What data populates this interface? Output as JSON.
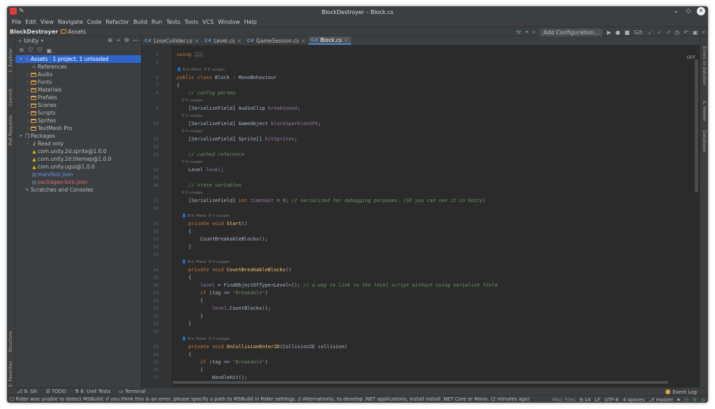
{
  "window": {
    "title": "BlockDestroyer – Block.cs"
  },
  "menu": [
    "File",
    "Edit",
    "View",
    "Navigate",
    "Code",
    "Refactor",
    "Build",
    "Run",
    "Tests",
    "Tools",
    "VCS",
    "Window",
    "Help"
  ],
  "breadcrumb": {
    "project": "BlockDestroyer",
    "folder": "Assets"
  },
  "toolbar": {
    "add_config": "Add Configuration...",
    "git_label": "Git:"
  },
  "project_panel": {
    "title": "Unity"
  },
  "tree": [
    {
      "indent": 0,
      "arrow": "▾",
      "icon": "unity",
      "label": "Assets · 1 project, 1 unloaded",
      "selected": true
    },
    {
      "indent": 1,
      "arrow": "",
      "icon": "refs",
      "label": "References"
    },
    {
      "indent": 1,
      "arrow": "›",
      "icon": "folder",
      "label": "Audio"
    },
    {
      "indent": 1,
      "arrow": "›",
      "icon": "folder",
      "label": "Fonts"
    },
    {
      "indent": 1,
      "arrow": "›",
      "icon": "folder",
      "label": "Materials"
    },
    {
      "indent": 1,
      "arrow": "›",
      "icon": "folder",
      "label": "Prefabs"
    },
    {
      "indent": 1,
      "arrow": "›",
      "icon": "folder",
      "label": "Scenes"
    },
    {
      "indent": 1,
      "arrow": "›",
      "icon": "folder",
      "label": "Scripts"
    },
    {
      "indent": 1,
      "arrow": "›",
      "icon": "folder",
      "label": "Sprites"
    },
    {
      "indent": 1,
      "arrow": "›",
      "icon": "folder",
      "label": "TextMesh Pro"
    },
    {
      "indent": 0,
      "arrow": "▾",
      "icon": "package",
      "label": "Packages"
    },
    {
      "indent": 1,
      "arrow": "›",
      "icon": "readonly",
      "label": "Read only"
    },
    {
      "indent": 1,
      "arrow": "",
      "icon": "warn",
      "label": "com.unity.2d.sprite@1.0.0"
    },
    {
      "indent": 1,
      "arrow": "",
      "icon": "warn",
      "label": "com.unity.2d.tilemap@1.0.0"
    },
    {
      "indent": 1,
      "arrow": "",
      "icon": "warn",
      "label": "com.unity.ugui@1.0.0"
    },
    {
      "indent": 1,
      "arrow": "",
      "icon": "json",
      "label": "manifest.json",
      "color": "blue"
    },
    {
      "indent": 1,
      "arrow": "",
      "icon": "json",
      "label": "packages-lock.json",
      "color": "red"
    },
    {
      "indent": 0,
      "arrow": "",
      "icon": "scratch",
      "label": "Scratches and Consoles"
    }
  ],
  "tabs": [
    {
      "label": "LoseCollider.cs",
      "active": false
    },
    {
      "label": "Level.cs",
      "active": false
    },
    {
      "label": "GameSession.cs",
      "active": false
    },
    {
      "label": "Block.cs",
      "active": true
    }
  ],
  "editor": {
    "inlay_off": "OFF"
  },
  "code": [
    {
      "n": "1",
      "html": "<span class='kw'>using</span> <span style='background:#3b3b3b;color:#888'>...</span>"
    },
    {
      "n": "5",
      "html": ""
    },
    {
      "hint": "👤 Eric Mesa  ⚲ 6 usages"
    },
    {
      "n": "6",
      "html": "<span class='kw'>public class</span> Block : MonoBehaviour"
    },
    {
      "n": "7",
      "html": "{"
    },
    {
      "n": "8",
      "html": "    <span class='cm'>// config params</span>"
    },
    {
      "hint": "    ⚲ 0 usages"
    },
    {
      "n": "9",
      "html": "    [SerializeField] AudioClip <span class='fld'>breakSound</span>;"
    },
    {
      "hint": "    ⚲ 0 usages"
    },
    {
      "n": "10",
      "html": "    [SerializeField] GameObject <span class='fld'>blockSparklesVFX</span>;"
    },
    {
      "hint": "    ⚲ 0 usages"
    },
    {
      "n": "11",
      "html": "    [SerializeField] Sprite[] <span class='fld'>hitSprites</span>;"
    },
    {
      "n": "12",
      "html": ""
    },
    {
      "n": "13",
      "html": "    <span class='cm'>// cached reference</span>"
    },
    {
      "hint": "    ⚲ 0 usages"
    },
    {
      "n": "14",
      "html": "    Level <span class='fld'>level</span>;"
    },
    {
      "n": "15",
      "html": ""
    },
    {
      "n": "16",
      "html": "    <span class='cm'>// state variables</span>"
    },
    {
      "hint": "    ⚲ 0 usages"
    },
    {
      "n": "17",
      "html": "    [SerializeField] <span class='kw'>int</span> <span class='fld'>timesHit</span> = <span class='num'>0</span>; <span class='cm'>// serialized for debugging purposes. (SO you can see it in Unity)</span>"
    },
    {
      "n": "18",
      "html": ""
    },
    {
      "hint": "    👤 Eric Mesa  ⚲ 0 usages"
    },
    {
      "n": "19",
      "html": "    <span class='kw'>private void</span> <span class='mth'>Start</span>()"
    },
    {
      "n": "20",
      "html": "    {"
    },
    {
      "n": "21",
      "html": "        CountBreakableBlocks();"
    },
    {
      "n": "22",
      "html": "    }"
    },
    {
      "n": "23",
      "html": ""
    },
    {
      "hint": "    👤 Eric Mesa  ⚲ 0 usages"
    },
    {
      "n": "24",
      "html": "    <span class='kw'>private void</span> <span class='mth'>CountBreakableBlocks</span>()"
    },
    {
      "n": "25",
      "html": "    {"
    },
    {
      "n": "26",
      "html": "        <span class='fld'>level</span> = FindObjectOfType&lt;Level&gt;(); <span class='cm'>// a way to link to the level script without using serialize field</span>"
    },
    {
      "n": "27",
      "html": "        <span class='kw'>if</span> (tag == <span class='str'>\"Breakable\"</span>)"
    },
    {
      "n": "28",
      "html": "        {"
    },
    {
      "n": "29",
      "html": "            <span class='fld'>level</span>.CountBlocks();"
    },
    {
      "n": "30",
      "html": "        }"
    },
    {
      "n": "31",
      "html": "    }"
    },
    {
      "n": "32",
      "html": ""
    },
    {
      "hint": "    👤 Eric Mesa  ⚲ 0 usages"
    },
    {
      "n": "33",
      "html": "    <span class='kw'>private void</span> <span class='mth'>OnCollisionEnter2D</span>(Collision2D collision)"
    },
    {
      "n": "34",
      "html": "    {"
    },
    {
      "n": "35",
      "html": "        <span class='kw'>if</span> (tag == <span class='str'>\"Breakable\"</span>)"
    },
    {
      "n": "36",
      "html": "        {"
    },
    {
      "n": "37",
      "html": "            HandleHit();"
    }
  ],
  "left_tabs": {
    "explorer": "1: Explorer",
    "commit": "Commit",
    "pull": "Pull Requests",
    "structure": "Structure",
    "favorites": "2: Favorites"
  },
  "right_tabs": {
    "errors": "Errors In Solution",
    "iltools": "IL Viewer",
    "database": "Database"
  },
  "bottom_tools": {
    "git": "9: Git",
    "todo": "TODO",
    "unit": "8: Unit Tests",
    "terminal": "Terminal",
    "event_log": "Event Log"
  },
  "status": {
    "message": "Rider was unable to detect MSBuild: If you think this is an error, please specify a path to MSBuild in Rider settings. // Alternatively, to develop .NET applications, install install .NET Core or Mono. (2 minutes ago)",
    "misc": "Misc Files",
    "pos": "6:14",
    "eol": "LF",
    "enc": "UTF-8",
    "indent": "4 spaces",
    "branch": "master"
  }
}
